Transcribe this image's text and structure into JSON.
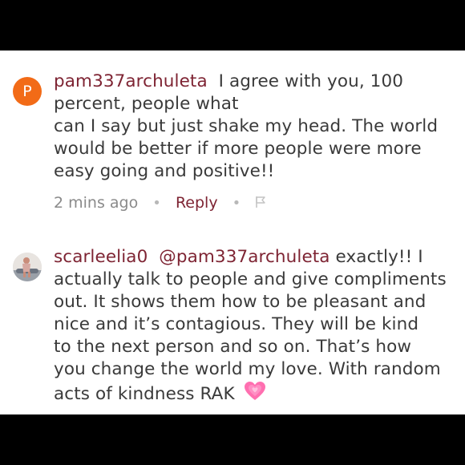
{
  "comments": [
    {
      "avatar_letter": "P",
      "username": "pam337archuleta",
      "lines": [
        "I agree with you, 100",
        "percent, people what",
        "can I say but just shake my head. The world",
        "would be better if more people were more",
        "easy going and positive!!"
      ],
      "timestamp": "2 mins ago",
      "reply_label": "Reply",
      "bullet": "•",
      "flag_icon": "flag-icon"
    },
    {
      "username": "scarleelia0",
      "mention": "@pam337archuleta",
      "lines": [
        "exactly!! I",
        "actually talk to people and give compliments",
        "out. It shows them how to be pleasant and",
        "nice and it’s contagious.  They will be kind",
        "to the next person and so on. That’s how",
        "you change the world my love. With random",
        "acts of kindness RAK"
      ],
      "emoji_icon": "growing-heart-icon"
    }
  ],
  "colors": {
    "username": "#7e2433",
    "text": "#3a3a3a",
    "meta": "#8a8a8a",
    "avatar_orange": "#f26b17",
    "heart": "#ff5fa2"
  }
}
